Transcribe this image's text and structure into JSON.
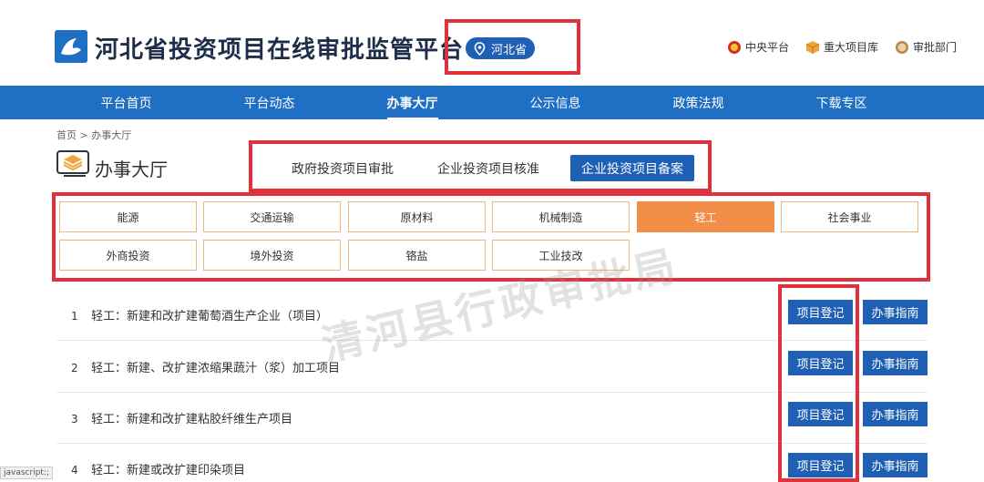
{
  "header": {
    "site_title": "河北省投资项目在线审批监管平台",
    "region": "河北省",
    "links": [
      {
        "label": "中央平台",
        "icon": "emblem-icon"
      },
      {
        "label": "重大项目库",
        "icon": "cube-icon"
      },
      {
        "label": "审批部门",
        "icon": "badge-icon"
      }
    ]
  },
  "nav": {
    "items": [
      "平台首页",
      "平台动态",
      "办事大厅",
      "公示信息",
      "政策法规",
      "下载专区"
    ],
    "active_index": 2
  },
  "breadcrumb": "首页 > 办事大厅",
  "section_title": "办事大厅",
  "tabs": [
    "政府投资项目审批",
    "企业投资项目核准",
    "企业投资项目备案"
  ],
  "categories": [
    "能源",
    "交通运输",
    "原材料",
    "机械制造",
    "轻工",
    "社会事业",
    "外商投资",
    "境外投资",
    "铬盐",
    "工业技改"
  ],
  "active_category": "轻工",
  "projects": [
    {
      "num": "1",
      "title": "轻工：新建和改扩建葡萄酒生产企业（项目）"
    },
    {
      "num": "2",
      "title": "轻工：新建、改扩建浓缩果蔬汁（浆）加工项目"
    },
    {
      "num": "3",
      "title": "轻工：新建和改扩建粘胶纤维生产项目"
    },
    {
      "num": "4",
      "title": "轻工：新建或改扩建印染项目"
    }
  ],
  "buttons": {
    "register": "项目登记",
    "guide": "办事指南"
  },
  "watermark": "清河县行政审批局",
  "status_text": "javascript:;",
  "colors": {
    "primary": "#1f6fc4",
    "button": "#1f5fb4",
    "accent": "#f38e48",
    "highlight": "#e0313d"
  }
}
